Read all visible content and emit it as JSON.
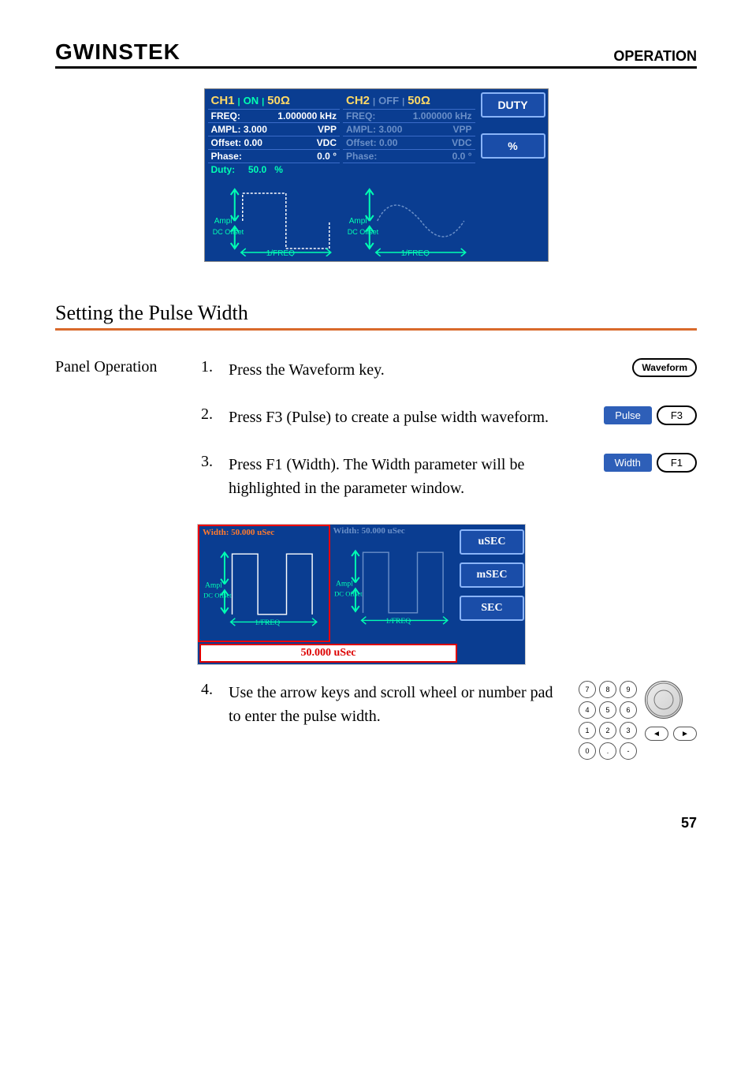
{
  "header": {
    "logo": "GWINSTEK",
    "section": "OPERATION"
  },
  "screen1": {
    "ch1": {
      "title": "CH1",
      "state": "ON",
      "imp": "50Ω",
      "freq_label": "FREQ:",
      "freq": "1.000000 kHz",
      "ampl_label": "AMPL:",
      "ampl": "3.000",
      "ampl_unit": "VPP",
      "off_label": "Offset:",
      "off": "0.00",
      "off_unit": "VDC",
      "phase_label": "Phase:",
      "phase": "0.0 °",
      "duty_label": "Duty:",
      "duty": "50.0",
      "duty_unit": "%",
      "ampl_txt": "Ampl",
      "dc_txt": "DC Offset",
      "freq_txt": "1/FREQ"
    },
    "ch2": {
      "title": "CH2",
      "state": "OFF",
      "imp": "50Ω",
      "freq_label": "FREQ:",
      "freq": "1.000000 kHz",
      "ampl_label": "AMPL:",
      "ampl": "3.000",
      "ampl_unit": "VPP",
      "off_label": "Offset:",
      "off": "0.00",
      "off_unit": "VDC",
      "phase_label": "Phase:",
      "phase": "0.0 °",
      "ampl_txt": "Ampl",
      "dc_txt": "DC Offset",
      "freq_txt": "1/FREQ"
    },
    "side": {
      "duty": "DUTY",
      "pct": "%"
    }
  },
  "heading": "Setting the Pulse Width",
  "left_label": "Panel Operation",
  "steps": {
    "s1": {
      "num": "1.",
      "text": "Press the Waveform key.",
      "key": "Waveform"
    },
    "s2": {
      "num": "2.",
      "text": "Press F3 (Pulse) to create a pulse width waveform.",
      "soft": "Pulse",
      "f": "F3"
    },
    "s3": {
      "num": "3.",
      "text": "Press F1 (Width). The Width parameter will be highlighted in the parameter window.",
      "soft": "Width",
      "f": "F1"
    },
    "s4": {
      "num": "4.",
      "text": "Use the arrow keys and scroll wheel or number pad to enter the pulse width."
    }
  },
  "screen2": {
    "ch1": {
      "label": "Width:",
      "val": "50.000 uSec",
      "ampl_txt": "Ampl",
      "dc_txt": "DC Offset",
      "freq_txt": "1/FREQ"
    },
    "ch2": {
      "label": "Width:",
      "val": "50.000 uSec",
      "ampl_txt": "Ampl",
      "dc_txt": "DC Offset",
      "freq_txt": "1/FREQ"
    },
    "value_bar": "50.000 uSec",
    "side": {
      "u": "uSEC",
      "m": "mSEC",
      "s": "SEC"
    }
  },
  "keypad": [
    "7",
    "8",
    "9",
    "4",
    "5",
    "6",
    "1",
    "2",
    "3",
    "0",
    ".",
    "-"
  ],
  "arrows": {
    "left": "◄",
    "right": "►"
  },
  "page_num": "57"
}
